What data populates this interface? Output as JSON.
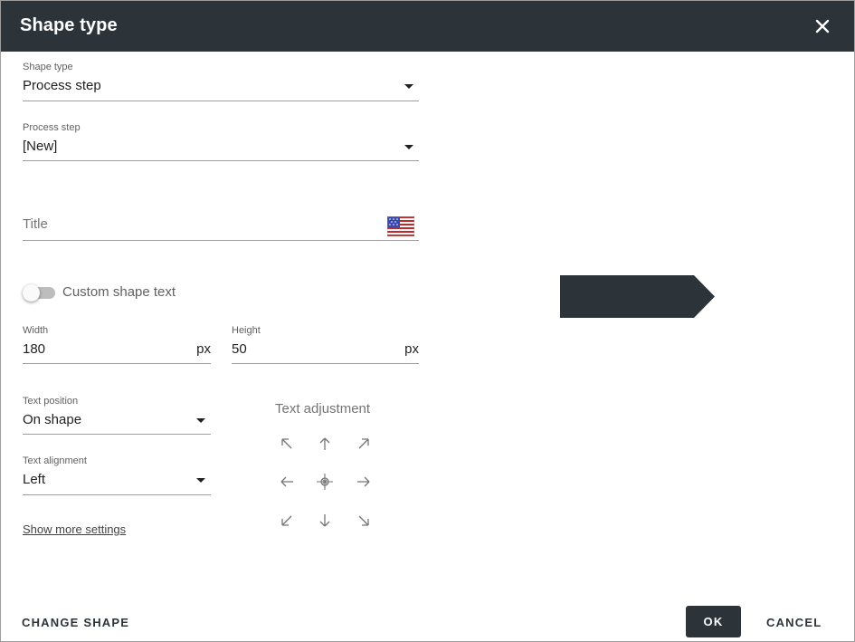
{
  "dialog": {
    "title": "Shape type",
    "close_icon": "close-icon"
  },
  "shape_type": {
    "label": "Shape type",
    "value": "Process step"
  },
  "process_step": {
    "label": "Process step",
    "value": "[New]"
  },
  "title_field": {
    "placeholder": "Title",
    "flag_icon": "us-flag-icon"
  },
  "custom_text": {
    "label": "Custom shape text",
    "enabled": false
  },
  "width": {
    "label": "Width",
    "value": "180",
    "unit": "px"
  },
  "height": {
    "label": "Height",
    "value": "50",
    "unit": "px"
  },
  "text_position": {
    "label": "Text position",
    "value": "On shape"
  },
  "text_alignment": {
    "label": "Text alignment",
    "value": "Left"
  },
  "text_adjustment": {
    "label": "Text adjustment",
    "arrows": [
      "arrow-up-left-icon",
      "arrow-up-icon",
      "arrow-up-right-icon",
      "arrow-left-icon",
      "center-crosshair-icon",
      "arrow-right-icon",
      "arrow-down-left-icon",
      "arrow-down-icon",
      "arrow-down-right-icon"
    ]
  },
  "links": {
    "show_more": "Show more settings"
  },
  "buttons": {
    "change_shape": "CHANGE SHAPE",
    "ok": "OK",
    "cancel": "CANCEL"
  },
  "colors": {
    "header": "#2d3439",
    "shape_fill": "#2d3439"
  }
}
